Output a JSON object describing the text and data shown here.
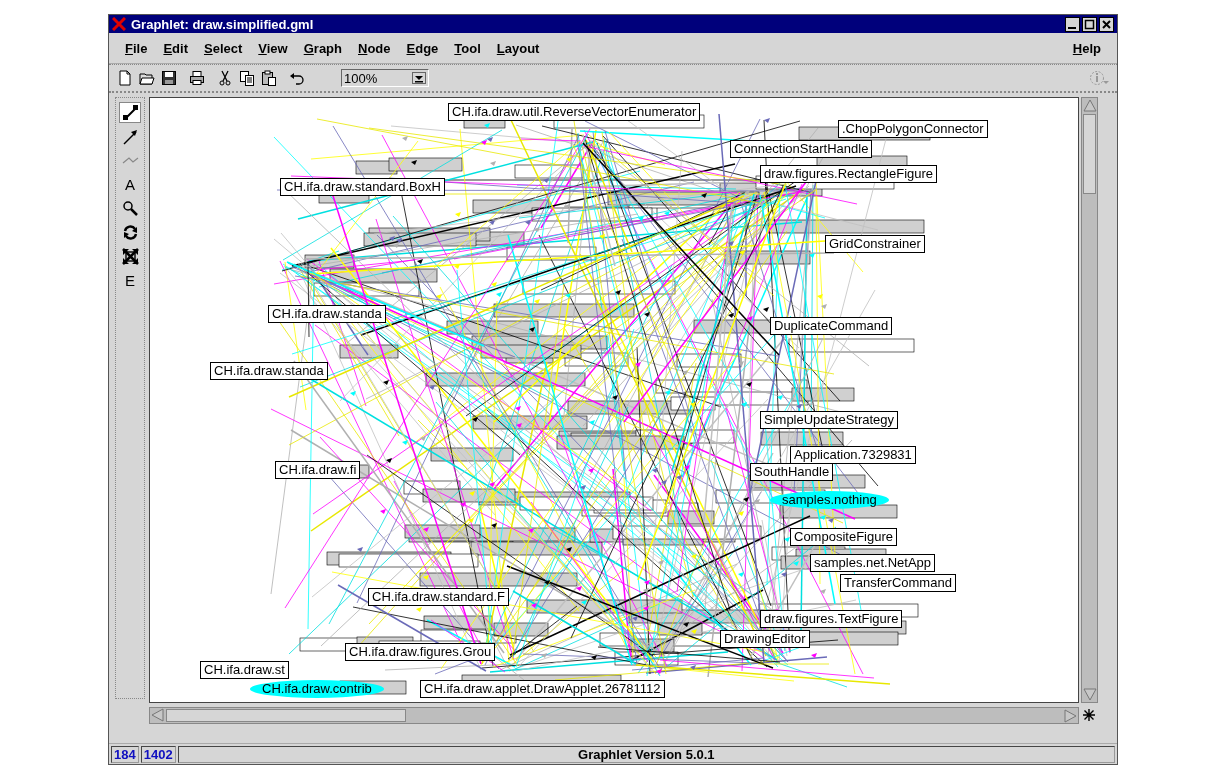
{
  "window": {
    "title": "Graphlet: draw.simplified.gml"
  },
  "menu": [
    {
      "label": "File"
    },
    {
      "label": "Edit"
    },
    {
      "label": "Select"
    },
    {
      "label": "View"
    },
    {
      "label": "Graph"
    },
    {
      "label": "Node"
    },
    {
      "label": "Edge"
    },
    {
      "label": "Tool"
    },
    {
      "label": "Layout"
    }
  ],
  "help_menu": {
    "label": "Help"
  },
  "toolbar": {
    "zoom": "100%"
  },
  "tools": [
    {
      "kind": "edit",
      "selected": true
    },
    {
      "kind": "arrow",
      "selected": false
    },
    {
      "kind": "bend",
      "selected": false
    },
    {
      "kind": "text",
      "label": "A",
      "selected": false
    },
    {
      "kind": "zoom",
      "selected": false
    },
    {
      "kind": "rotate",
      "selected": false
    },
    {
      "kind": "fit",
      "selected": false
    },
    {
      "kind": "text",
      "label": "E",
      "selected": false
    }
  ],
  "graph": {
    "nodes": [
      {
        "kind": "box",
        "label": "CH.ifa.draw.util.ReverseVectorEnumerator"
      },
      {
        "kind": "box",
        "label": ".ChopPolygonConnector"
      },
      {
        "kind": "box",
        "label": "ConnectionStartHandle"
      },
      {
        "kind": "box",
        "label": "draw.figures.RectangleFigure"
      },
      {
        "kind": "box",
        "label": "GridConstrainer"
      },
      {
        "kind": "box",
        "label": "DuplicateCommand"
      },
      {
        "kind": "box",
        "label": "SimpleUpdateStrategy"
      },
      {
        "kind": "box",
        "label": "Application.7329831"
      },
      {
        "kind": "box",
        "label": "SouthHandle"
      },
      {
        "kind": "ellipse",
        "label": "samples.nothing",
        "color": "#00ffff"
      },
      {
        "kind": "box",
        "label": "CompositeFigure"
      },
      {
        "kind": "box",
        "label": "samples.net.NetApp"
      },
      {
        "kind": "box",
        "label": "TransferCommand"
      },
      {
        "kind": "box",
        "label": "draw.figures.TextFigure"
      },
      {
        "kind": "box",
        "label": "DrawingEditor"
      },
      {
        "kind": "box",
        "label": "CH.ifa.draw.standard.BoxH"
      },
      {
        "kind": "box",
        "label": "CH.ifa.draw.standa"
      },
      {
        "kind": "box",
        "label": "CH.ifa.draw.standa"
      },
      {
        "kind": "box",
        "label": "CH.ifa.draw.fi"
      },
      {
        "kind": "box",
        "label": "CH.ifa.draw.standard.F"
      },
      {
        "kind": "box",
        "label": "CH.ifa.draw.figures.Grou"
      },
      {
        "kind": "box",
        "label": "CH.ifa.draw.st"
      },
      {
        "kind": "ellipse",
        "label": "CH.ifa.draw.contrib",
        "color": "#00ffff"
      },
      {
        "kind": "box",
        "label": "CH.ifa.draw.applet.DrawApplet.26781112"
      }
    ]
  },
  "status_bar": {
    "nodes": "184",
    "edges": "1402",
    "message": "Graphlet Version 5.0.1"
  }
}
